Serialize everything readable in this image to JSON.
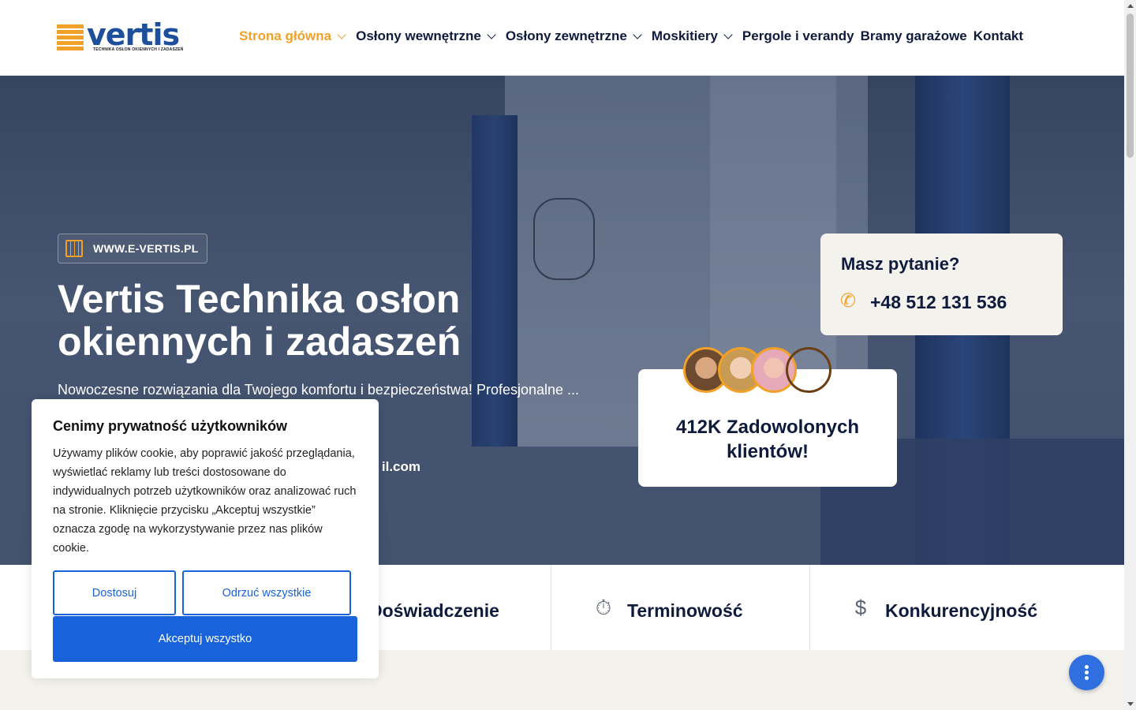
{
  "header": {
    "logo": {
      "wordmark": "vertis",
      "tagline": "TECHNIKA OSŁON OKIENNYCH I ZADASZEŃ",
      "brand_color": "#1e4f9c",
      "accent_color": "#f2a128"
    },
    "nav": [
      {
        "label": "Strona główna",
        "has_dropdown": true,
        "active": true
      },
      {
        "label": "Osłony wewnętrzne",
        "has_dropdown": true
      },
      {
        "label": "Osłony zewnętrzne",
        "has_dropdown": true
      },
      {
        "label": "Moskitiery",
        "has_dropdown": true
      },
      {
        "label": "Pergole i verandy",
        "has_dropdown": false
      },
      {
        "label": "Bramy garażowe",
        "has_dropdown": false
      },
      {
        "label": "Kontakt",
        "has_dropdown": false
      }
    ]
  },
  "hero": {
    "badge": "WWW.E-VERTIS.PL",
    "title": "Vertis Technika osłon okiennych i zadaszeń",
    "subtitle": "Nowoczesne rozwiązania dla Twojego komfortu i bezpieczeństwa! Profesjonalne ... omu, firmy i przemysłu.",
    "email_fragment": "il.com",
    "question_card": {
      "title": "Masz pytanie?",
      "phone": "+48 512 131 536",
      "icon": "phone-icon"
    },
    "clients_card": {
      "text": "412K Zadowolonych klientów!"
    }
  },
  "features": [
    {
      "icon": "experience-icon",
      "label": "Doświadczenie"
    },
    {
      "icon": "stopwatch-icon",
      "label": "Terminowość"
    },
    {
      "icon": "money-hand-icon",
      "label": "Konkurencyjność"
    }
  ],
  "cookie": {
    "title": "Cenimy prywatność użytkowników",
    "body": "Używamy plików cookie, aby poprawić jakość przeglądania, wyświetlać reklamy lub treści dostosowane do indywidualnych potrzeb użytkowników oraz analizować ruch na stronie. Kliknięcie przycisku „Akceptuj wszystkie” oznacza zgodę na wykorzystywanie przez nas plików cookie.",
    "customize_label": "Dostosuj",
    "reject_label": "Odrzuć wszystkie",
    "accept_label": "Akceptuj wszystko",
    "accent_color": "#1863dc"
  }
}
